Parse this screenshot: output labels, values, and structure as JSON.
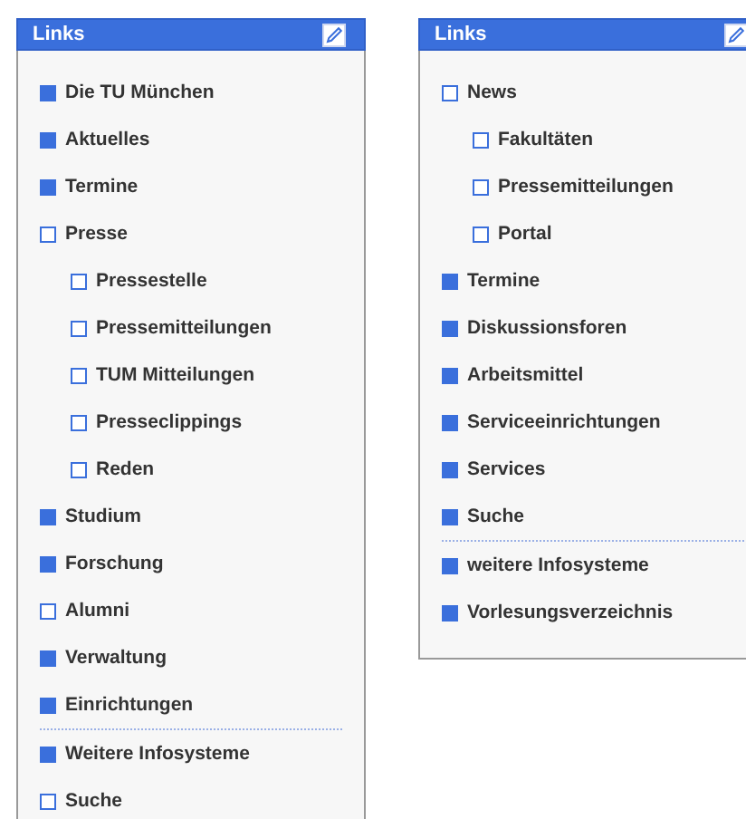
{
  "panels": [
    {
      "title": "Links",
      "sections": [
        [
          {
            "label": "Die TU München",
            "kind": "filled"
          },
          {
            "label": "Aktuelles",
            "kind": "filled"
          },
          {
            "label": "Termine",
            "kind": "filled"
          },
          {
            "label": "Presse",
            "kind": "hollow",
            "children": [
              {
                "label": "Pressestelle",
                "kind": "hollow"
              },
              {
                "label": "Pressemitteilungen",
                "kind": "hollow"
              },
              {
                "label": "TUM Mitteilungen",
                "kind": "hollow"
              },
              {
                "label": "Presseclippings",
                "kind": "hollow"
              },
              {
                "label": "Reden",
                "kind": "hollow"
              }
            ]
          },
          {
            "label": "Studium",
            "kind": "filled"
          },
          {
            "label": "Forschung",
            "kind": "filled"
          },
          {
            "label": "Alumni",
            "kind": "hollow"
          },
          {
            "label": "Verwaltung",
            "kind": "filled"
          },
          {
            "label": "Einrichtungen",
            "kind": "filled"
          }
        ],
        [
          {
            "label": "Weitere Infosysteme",
            "kind": "filled"
          },
          {
            "label": "Suche",
            "kind": "hollow"
          }
        ]
      ]
    },
    {
      "title": "Links",
      "sections": [
        [
          {
            "label": "News",
            "kind": "hollow",
            "children": [
              {
                "label": "Fakultäten",
                "kind": "hollow"
              },
              {
                "label": "Pressemitteilungen",
                "kind": "hollow"
              },
              {
                "label": "Portal",
                "kind": "hollow"
              }
            ]
          },
          {
            "label": "Termine",
            "kind": "filled"
          },
          {
            "label": "Diskussionsforen",
            "kind": "filled"
          },
          {
            "label": "Arbeitsmittel",
            "kind": "filled"
          },
          {
            "label": "Serviceeinrichtungen",
            "kind": "filled"
          },
          {
            "label": "Services",
            "kind": "filled"
          },
          {
            "label": "Suche",
            "kind": "filled"
          }
        ],
        [
          {
            "label": "weitere Infosysteme",
            "kind": "filled"
          },
          {
            "label": "Vorlesungsverzeichnis",
            "kind": "filled"
          }
        ]
      ]
    }
  ]
}
